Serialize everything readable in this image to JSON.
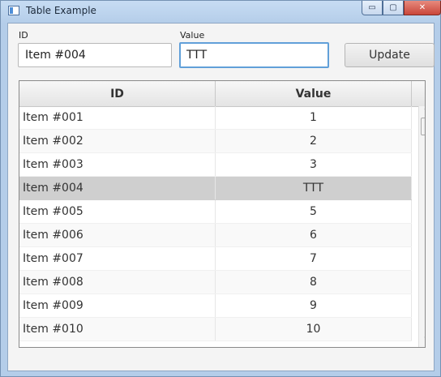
{
  "window": {
    "title": "Table Example",
    "minimize_glyph": "▭",
    "maximize_glyph": "▢",
    "close_glyph": "✕"
  },
  "form": {
    "id_label": "ID",
    "id_value": "Item #004",
    "value_label": "Value",
    "value_value": "TTT",
    "update_label": "Update"
  },
  "table": {
    "columns": [
      "ID",
      "Value"
    ],
    "selected_index": 3,
    "rows": [
      {
        "id": "Item #001",
        "value": "1"
      },
      {
        "id": "Item #002",
        "value": "2"
      },
      {
        "id": "Item #003",
        "value": "3"
      },
      {
        "id": "Item #004",
        "value": "TTT"
      },
      {
        "id": "Item #005",
        "value": "5"
      },
      {
        "id": "Item #006",
        "value": "6"
      },
      {
        "id": "Item #007",
        "value": "7"
      },
      {
        "id": "Item #008",
        "value": "8"
      },
      {
        "id": "Item #009",
        "value": "9"
      },
      {
        "id": "Item #010",
        "value": "10"
      }
    ]
  },
  "scrollbar": {
    "up_glyph": "˄",
    "down_glyph": "˅"
  },
  "colors": {
    "selection": "#cfcfcf",
    "focus_border": "#61a0d9",
    "close_button": "#c9463a"
  }
}
